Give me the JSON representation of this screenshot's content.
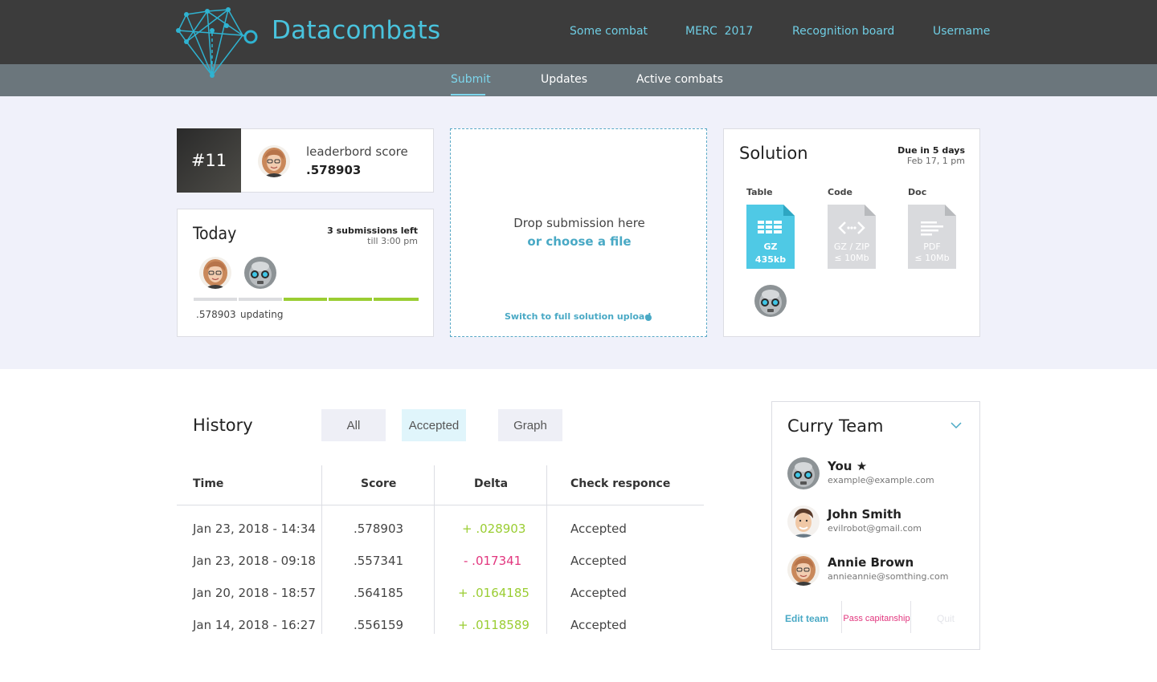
{
  "app": {
    "brand": "Datacombats"
  },
  "topnav": {
    "combat": "Some combat",
    "merc": "MERC  2017",
    "board": "Recognition board",
    "user": "Username"
  },
  "subnav": {
    "submit": "Submit",
    "updates": "Updates",
    "active": "Active combats"
  },
  "rank": {
    "position": "#11",
    "label": "leaderbord score",
    "score": ".578903"
  },
  "today": {
    "title": "Today",
    "submissions_left": "3 submissions left",
    "till": "till 3:00 pm",
    "first_score": ".578903",
    "second_status": "updating",
    "accent_color": "#9acd32"
  },
  "drop": {
    "main": "Drop submission here",
    "choose": "or choose a file",
    "switch": "Switch to full solution upload"
  },
  "solution": {
    "title": "Solution",
    "due": "Due in 5 days",
    "date": "Feb 17, 1 pm",
    "files": [
      {
        "label": "Table",
        "line1": "GZ",
        "line2": "435kb",
        "icon": "table-icon"
      },
      {
        "label": "Code",
        "line1": "GZ / ZIP",
        "line2": "≤ 10Mb",
        "icon": "code-icon"
      },
      {
        "label": "Doc",
        "line1": "PDF",
        "line2": "≤ 10Mb",
        "icon": "doc-icon"
      }
    ]
  },
  "history": {
    "title": "History",
    "filters": [
      "All",
      "Accepted",
      "Graph"
    ],
    "columns": [
      "Time",
      "Score",
      "Delta",
      "Check responce"
    ],
    "rows": [
      {
        "time": "Jan 23, 2018 - 14:34",
        "score": ".578903",
        "delta": "+ .028903",
        "status": "Accepted"
      },
      {
        "time": "Jan 23, 2018 - 09:18",
        "score": ".557341",
        "delta": "- .017341",
        "status": "Accepted"
      },
      {
        "time": "Jan 20, 2018 - 18:57",
        "score": ".564185",
        "delta": "+ .0164185",
        "status": "Accepted"
      },
      {
        "time": "Jan 14, 2018 - 16:27",
        "score": ".556159",
        "delta": "+ .0118589",
        "status": "Accepted"
      }
    ]
  },
  "team": {
    "title": "Curry Team",
    "members": [
      {
        "name": "You ★",
        "email": "example@example.com"
      },
      {
        "name": "John Smith",
        "email": "evilrobot@gmail.com"
      },
      {
        "name": "Annie Brown",
        "email": "annieannie@somthing.com"
      }
    ],
    "edit": "Edit team",
    "pass": "Pass capitanship",
    "quit": "Quit"
  }
}
